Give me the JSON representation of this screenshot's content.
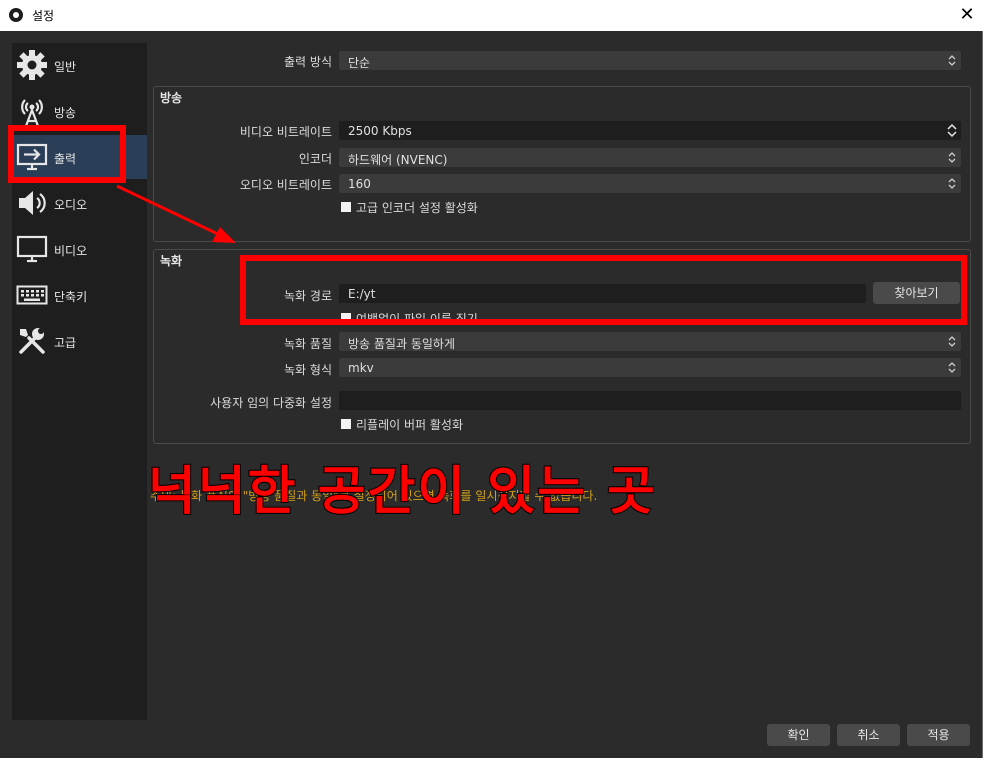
{
  "window": {
    "title": "설정",
    "close_glyph": "✕"
  },
  "sidebar": {
    "items": [
      {
        "label": "일반",
        "icon": "gear-icon"
      },
      {
        "label": "방송",
        "icon": "broadcast-icon"
      },
      {
        "label": "출력",
        "icon": "output-icon",
        "active": true
      },
      {
        "label": "오디오",
        "icon": "speaker-icon"
      },
      {
        "label": "비디오",
        "icon": "monitor-icon"
      },
      {
        "label": "단축키",
        "icon": "keyboard-icon"
      },
      {
        "label": "고급",
        "icon": "tools-icon"
      }
    ]
  },
  "output_mode": {
    "label": "출력 방식",
    "value": "단순"
  },
  "streaming": {
    "title": "방송",
    "video_bitrate": {
      "label": "비디오 비트레이트",
      "value": "2500 Kbps"
    },
    "encoder": {
      "label": "인코더",
      "value": "하드웨어 (NVENC)"
    },
    "audio_bitrate": {
      "label": "오디오 비트레이트",
      "value": "160"
    },
    "advanced_encoder": {
      "label": "고급 인코더 설정 활성화",
      "checked": false
    }
  },
  "recording": {
    "title": "녹화",
    "path": {
      "label": "녹화 경로",
      "value": "E:/yt",
      "browse": "찾아보기"
    },
    "no_space": {
      "label": "여백없이 파일 이름 짓기",
      "checked": false
    },
    "quality": {
      "label": "녹화 품질",
      "value": "방송 품질과 동일하게"
    },
    "format": {
      "label": "녹화 형식",
      "value": "mkv"
    },
    "muxer": {
      "label": "사용자 임의 다중화 설정",
      "value": ""
    },
    "replay_buffer": {
      "label": "리플레이 버퍼 활성화",
      "checked": false
    }
  },
  "warning": "주의: 녹화 품질이 \"방송 품질과 동일\"로 설정되어 있으면 녹화를 일시정지할 수 없습니다.",
  "annotation": "넉넉한 공간이 있는 곳",
  "buttons": {
    "ok": "확인",
    "cancel": "취소",
    "apply": "적용"
  },
  "colors": {
    "accent": "#2a3f57",
    "annotation_red": "#ff0000",
    "warning": "#d4a017"
  }
}
